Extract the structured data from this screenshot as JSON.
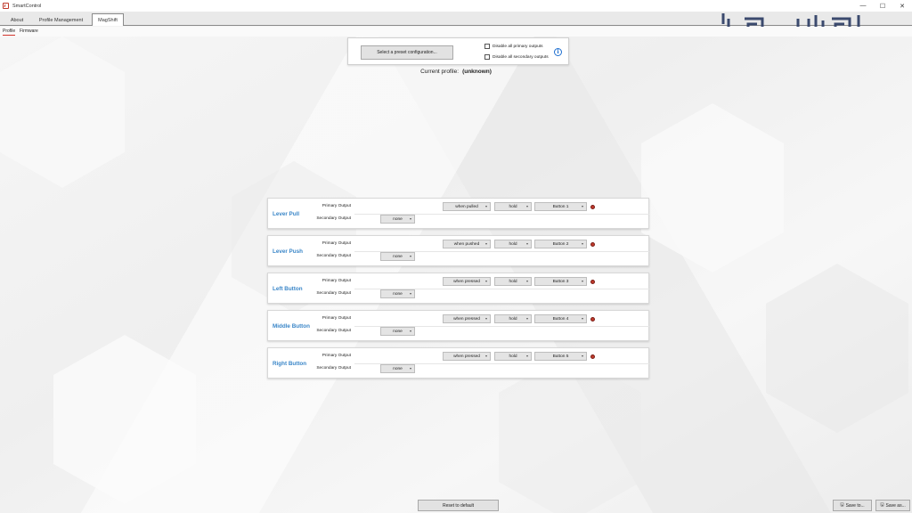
{
  "window": {
    "title": "SmartControl",
    "controls": [
      "—",
      "☐",
      "✕"
    ]
  },
  "tabs": [
    {
      "label": "About"
    },
    {
      "label": "Profile Management"
    },
    {
      "label": "MagShift"
    }
  ],
  "subtabs": [
    {
      "label": "Profile"
    },
    {
      "label": "Firmware"
    }
  ],
  "preset": {
    "button_label": "Select a preset configuration...",
    "disable_primary_label": "Disable all primary outputs",
    "disable_secondary_label": "Disable all secondary outputs",
    "disable_primary_checked": false,
    "disable_secondary_checked": false,
    "info_icon": "i"
  },
  "current_profile": {
    "label": "Current profile:",
    "value": "(unknown)"
  },
  "output_labels": {
    "primary": "Primary Output",
    "secondary": "Secondary Output"
  },
  "mappings": [
    {
      "name": "Lever Pull",
      "condition": "when pulled",
      "mode": "hold",
      "button": "Button 1",
      "secondary": "none"
    },
    {
      "name": "Lever Push",
      "condition": "when pushed",
      "mode": "hold",
      "button": "Button 2",
      "secondary": "none"
    },
    {
      "name": "Left Button",
      "condition": "when pressed",
      "mode": "hold",
      "button": "Button 3",
      "secondary": "none"
    },
    {
      "name": "Middle Button",
      "condition": "when pressed",
      "mode": "hold",
      "button": "Button 4",
      "secondary": "none"
    },
    {
      "name": "Right Button",
      "condition": "when pressed",
      "mode": "hold",
      "button": "Button 5",
      "secondary": "none"
    }
  ],
  "footer": {
    "reset_label": "Reset to default",
    "save_to_label": "Save to...",
    "save_as_label": "Save as..."
  },
  "colors": {
    "accent_red": "#d0342c",
    "title_blue": "#3a86c8",
    "led_red": "#c0392b"
  }
}
